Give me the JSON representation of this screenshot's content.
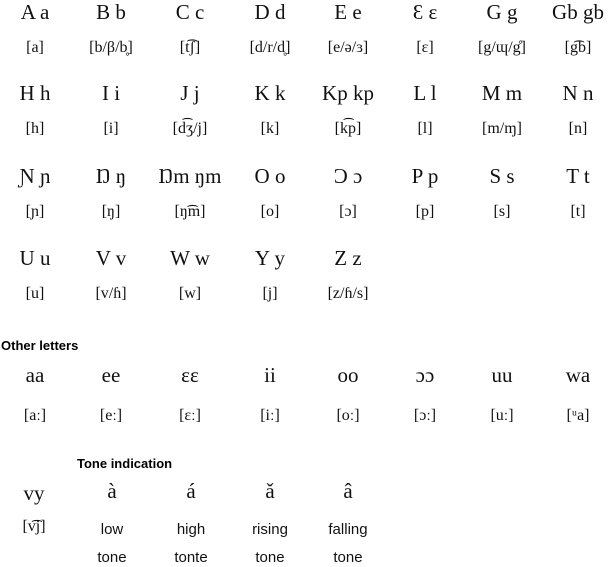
{
  "alphabet": [
    [
      {
        "letter": "A a",
        "ipa": "[a]"
      },
      {
        "letter": "B b",
        "ipa": "[b/β/b̥]"
      },
      {
        "letter": "C c",
        "ipa": "[t͡ʃ]"
      },
      {
        "letter": "D d",
        "ipa": "[d/r/d̥]"
      },
      {
        "letter": "E e",
        "ipa": "[e/ə/ɜ]"
      },
      {
        "letter": "Ɛ ɛ",
        "ipa": "[ɛ]"
      },
      {
        "letter": "G g",
        "ipa": "[g/ɰ/g̊]"
      },
      {
        "letter": "Gb gb",
        "ipa": "[g͡b]"
      }
    ],
    [
      {
        "letter": "H h",
        "ipa": "[h]"
      },
      {
        "letter": "I i",
        "ipa": "[i]"
      },
      {
        "letter": "J j",
        "ipa": "[d͡ʒ/j]"
      },
      {
        "letter": "K k",
        "ipa": "[k]"
      },
      {
        "letter": "Kp kp",
        "ipa": "[k͡p]"
      },
      {
        "letter": "L l",
        "ipa": "[l]"
      },
      {
        "letter": "M m",
        "ipa": "[m/ɱ]"
      },
      {
        "letter": "N n",
        "ipa": "[n]"
      }
    ],
    [
      {
        "letter": "Ɲ ɲ",
        "ipa": "[ɲ]"
      },
      {
        "letter": "Ŋ ŋ",
        "ipa": "[ŋ]"
      },
      {
        "letter": "Ŋm ŋm",
        "ipa": "[ŋ͡m]"
      },
      {
        "letter": "O o",
        "ipa": "[o]"
      },
      {
        "letter": "Ɔ ɔ",
        "ipa": "[ɔ]"
      },
      {
        "letter": "P p",
        "ipa": "[p]"
      },
      {
        "letter": "S s",
        "ipa": "[s]"
      },
      {
        "letter": "T t",
        "ipa": "[t]"
      }
    ],
    [
      {
        "letter": "U u",
        "ipa": "[u]"
      },
      {
        "letter": "V v",
        "ipa": "[v/ɦ]"
      },
      {
        "letter": "W w",
        "ipa": "[w]"
      },
      {
        "letter": "Y y",
        "ipa": "[j]"
      },
      {
        "letter": "Z z",
        "ipa": "[z/ɦ/s]"
      }
    ]
  ],
  "other_letters": {
    "heading": "Other letters",
    "items": [
      {
        "letter": "aa",
        "ipa": "[aː]"
      },
      {
        "letter": "ee",
        "ipa": "[eː]"
      },
      {
        "letter": "ɛɛ",
        "ipa": "[ɛː]"
      },
      {
        "letter": "ii",
        "ipa": "[iː]"
      },
      {
        "letter": "oo",
        "ipa": "[oː]"
      },
      {
        "letter": "ɔɔ",
        "ipa": "[ɔː]"
      },
      {
        "letter": "uu",
        "ipa": "[uː]"
      },
      {
        "letter": "wa",
        "ipa": "[ᵘa]"
      }
    ]
  },
  "extra_letter": {
    "letter": "vy",
    "ipa": "[v͡j]"
  },
  "tone_indication": {
    "heading": "Tone indication",
    "items": [
      {
        "mark": "à",
        "line1": "low",
        "line2": "tone"
      },
      {
        "mark": "á",
        "line1": "high",
        "line2": "tonte"
      },
      {
        "mark": "ǎ",
        "line1": "rising",
        "line2": "tone"
      },
      {
        "mark": "â",
        "line1": "falling",
        "line2": "tone"
      }
    ]
  }
}
